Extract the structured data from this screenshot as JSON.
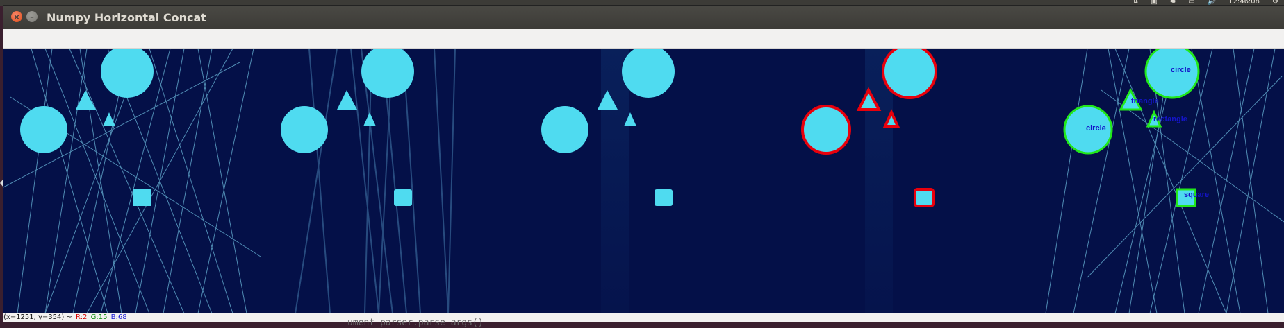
{
  "window": {
    "title": "Numpy Horizontal Concat"
  },
  "panel": {
    "clock": "12:46:08"
  },
  "status": {
    "coords": "(x=1251, y=354) ~",
    "r": "R:2",
    "g": "G:15",
    "b": "B:68"
  },
  "labels": {
    "circle_top": "circle",
    "circle_mid": "circle",
    "triangle": "triangle",
    "rectangle": "rectangle",
    "square": "square"
  },
  "terminal": {
    "text": "ument_parser.parse_args()"
  },
  "colors": {
    "background": "#041048",
    "shape_fill": "#4fdbf0",
    "contour_red": "#e8000c",
    "contour_green": "#22e81a",
    "label_blue": "#1414c8"
  }
}
